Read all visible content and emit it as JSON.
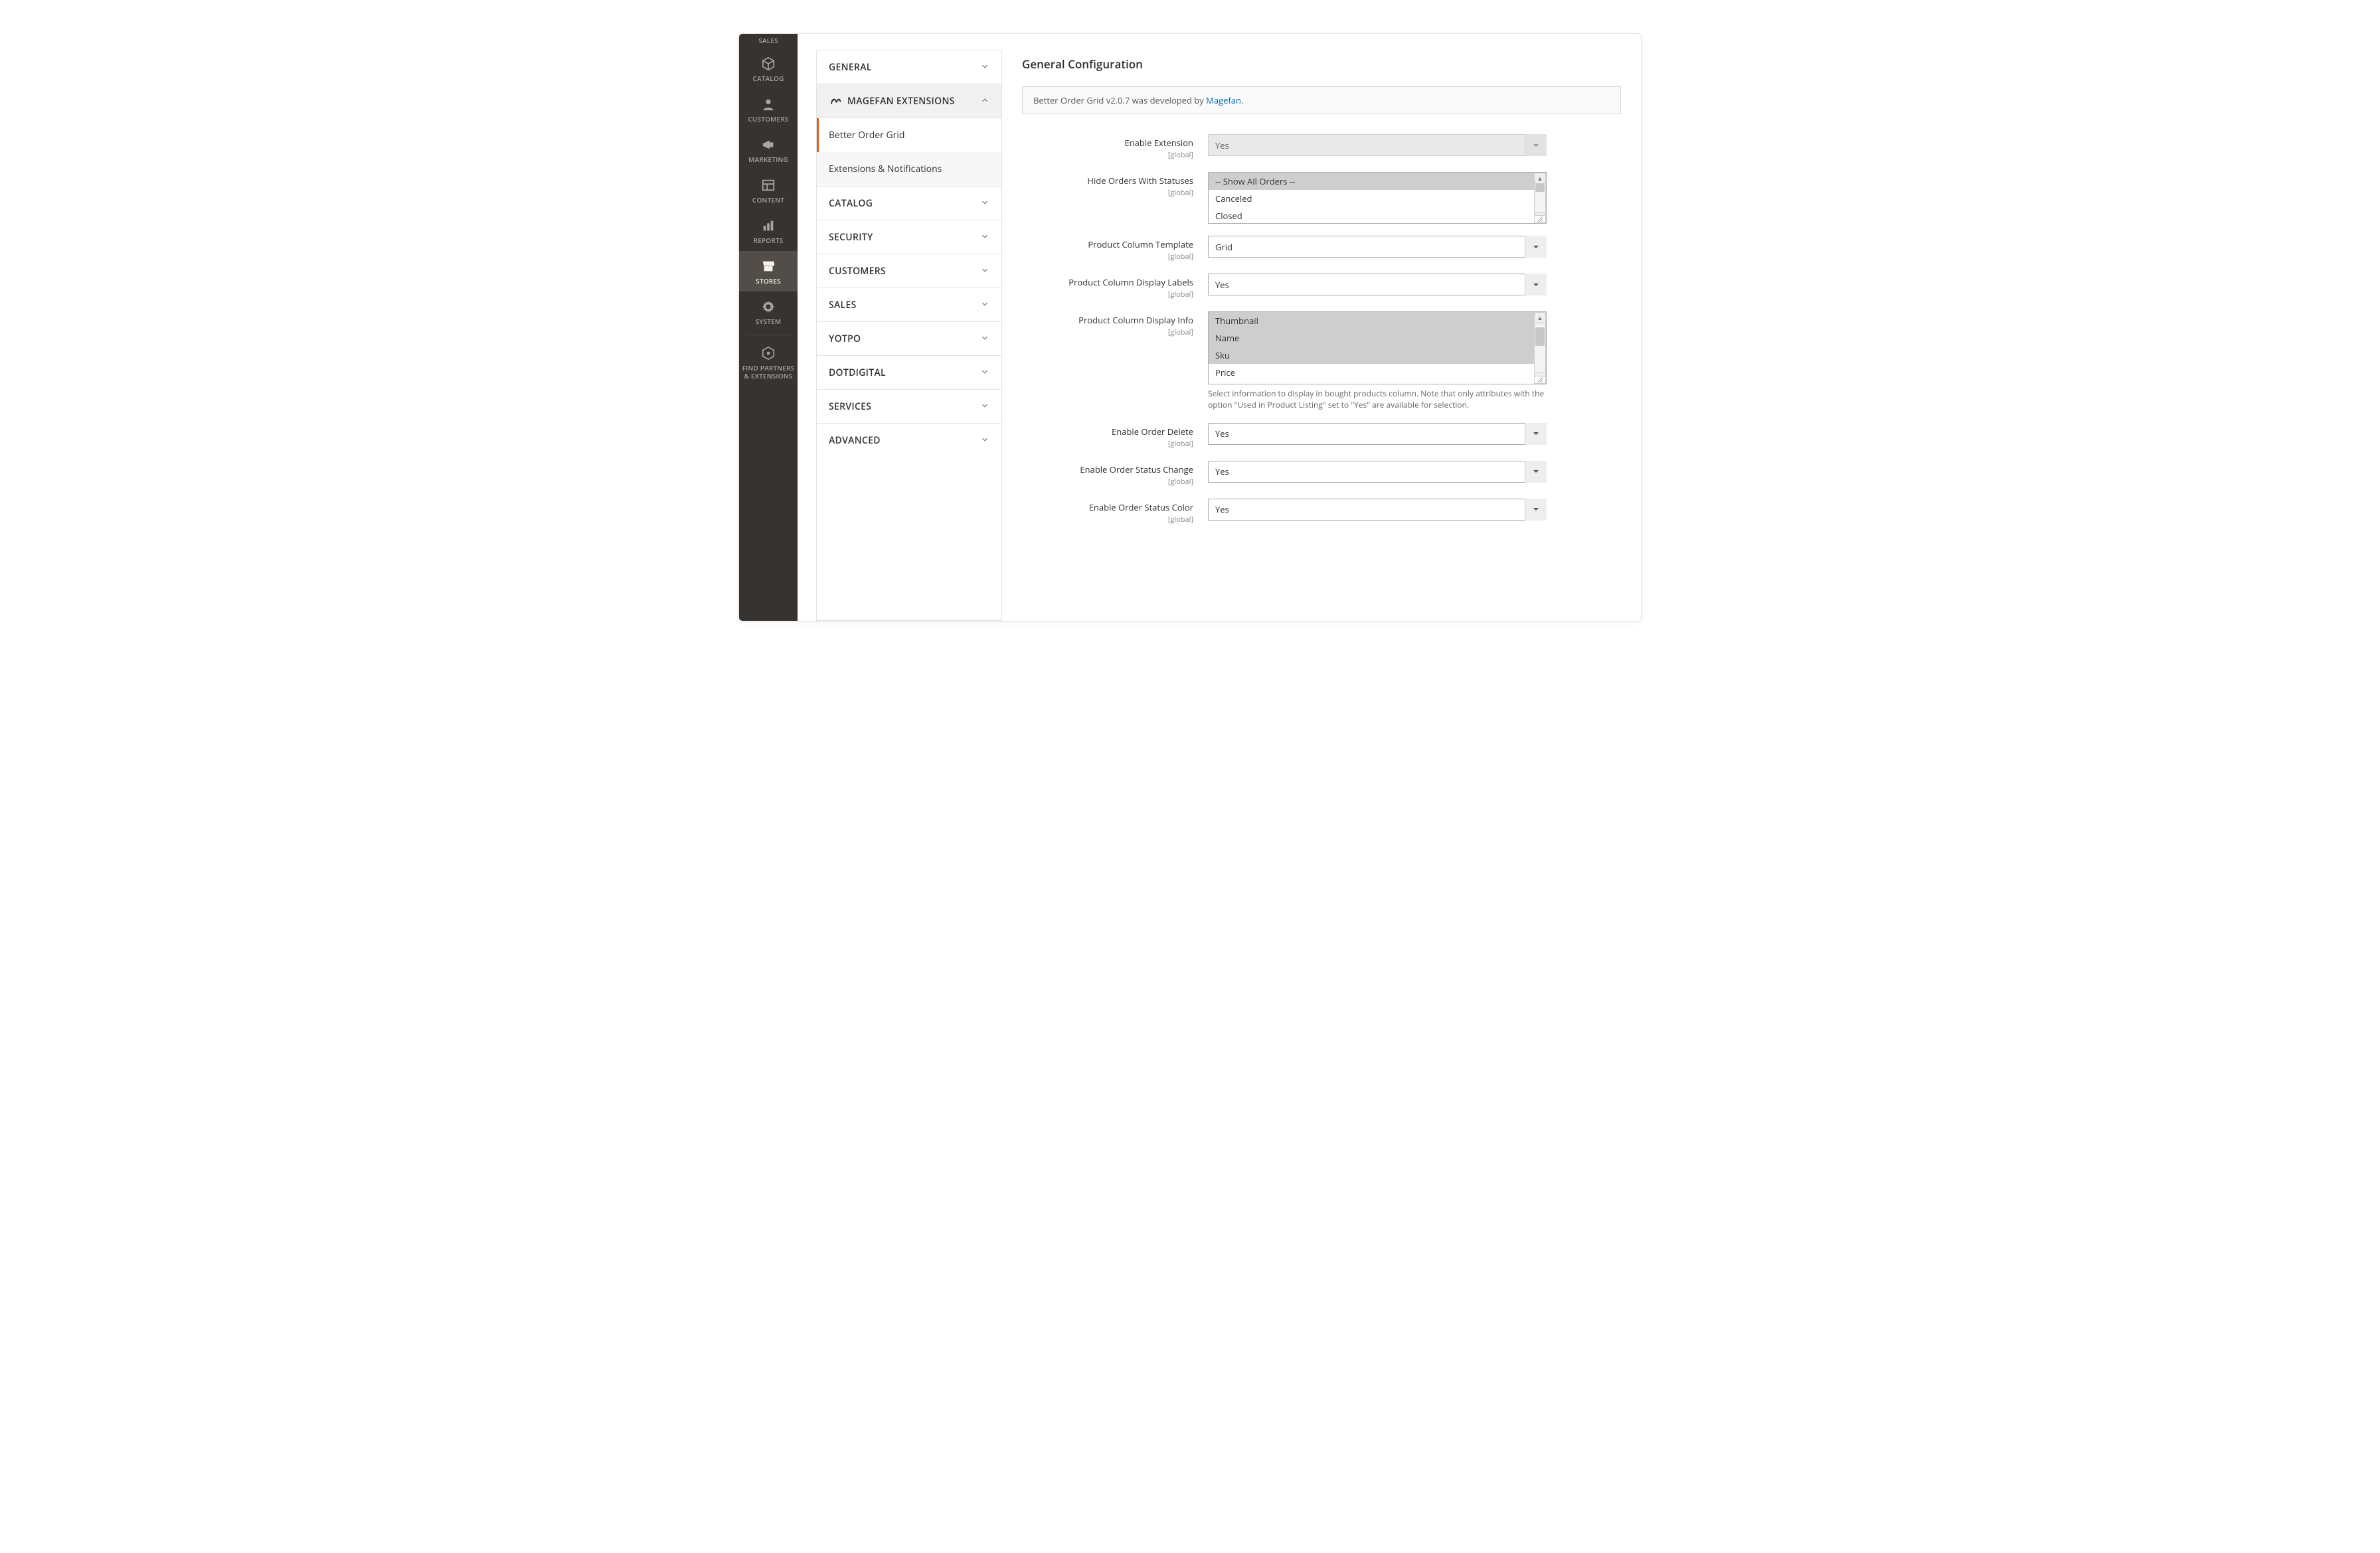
{
  "nav": {
    "items": [
      {
        "id": "sales",
        "label": "SALES"
      },
      {
        "id": "catalog",
        "label": "CATALOG"
      },
      {
        "id": "customers",
        "label": "CUSTOMERS"
      },
      {
        "id": "marketing",
        "label": "MARKETING"
      },
      {
        "id": "content",
        "label": "CONTENT"
      },
      {
        "id": "reports",
        "label": "REPORTS"
      },
      {
        "id": "stores",
        "label": "STORES"
      },
      {
        "id": "system",
        "label": "SYSTEM"
      },
      {
        "id": "partners",
        "label": "FIND PARTNERS & EXTENSIONS"
      }
    ]
  },
  "config_nav": {
    "general": "GENERAL",
    "magefan": "MAGEFAN EXTENSIONS",
    "magefan_sub": {
      "better_order_grid": "Better Order Grid",
      "extensions_notifications": "Extensions & Notifications"
    },
    "catalog": "CATALOG",
    "security": "SECURITY",
    "customers": "CUSTOMERS",
    "sales": "SALES",
    "yotpo": "YOTPO",
    "dotdigital": "DOTDIGITAL",
    "services": "SERVICES",
    "advanced": "ADVANCED"
  },
  "form": {
    "title": "General Configuration",
    "notice_prefix": "Better Order Grid v2.0.7 was developed by ",
    "notice_link": "Magefan",
    "notice_suffix": ".",
    "scope_global": "[global]",
    "fields": {
      "enable_extension": {
        "label": "Enable Extension",
        "value": "Yes"
      },
      "hide_orders": {
        "label": "Hide Orders With Statuses",
        "options": [
          "-- Show All Orders --",
          "Canceled",
          "Closed"
        ],
        "selected": [
          0
        ]
      },
      "product_template": {
        "label": "Product Column Template",
        "value": "Grid"
      },
      "product_labels": {
        "label": "Product Column Display Labels",
        "value": "Yes"
      },
      "product_info": {
        "label": "Product Column Display Info",
        "options": [
          "Thumbnail",
          "Name",
          "Sku",
          "Price"
        ],
        "selected": [
          0,
          1,
          2
        ],
        "help": "Select information to display in bought products column. Note that only attributes with the option \"Used in Product Listing\" set to \"Yes\" are available for selection."
      },
      "enable_delete": {
        "label": "Enable Order Delete",
        "value": "Yes"
      },
      "enable_status_change": {
        "label": "Enable Order Status Change",
        "value": "Yes"
      },
      "enable_status_color": {
        "label": "Enable Order Status Color",
        "value": "Yes"
      }
    }
  }
}
